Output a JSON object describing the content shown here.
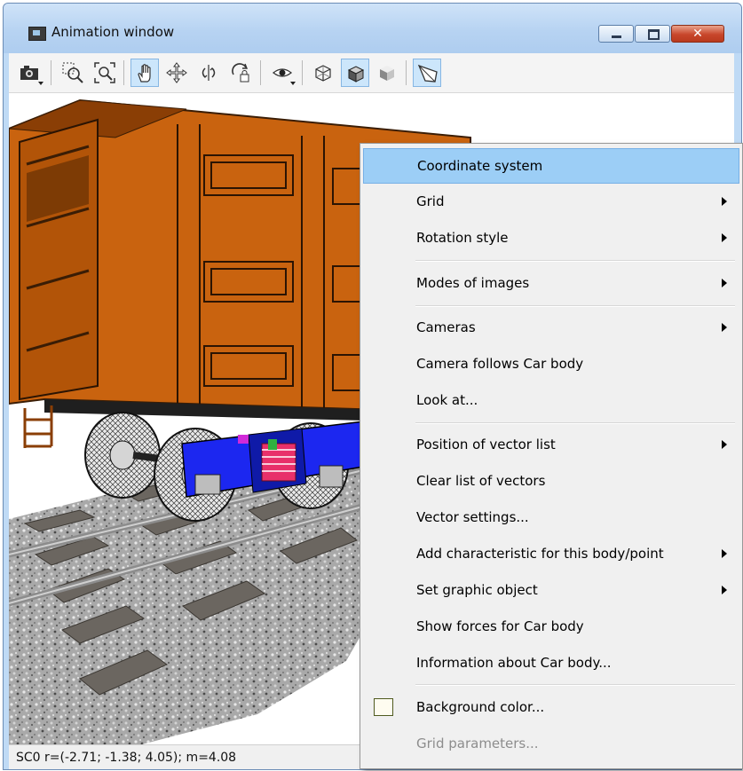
{
  "window": {
    "title": "Animation window",
    "close_glyph": "✕"
  },
  "toolbar": {
    "buttons": [
      {
        "icon": "camera-snapshot-icon",
        "active": false
      },
      {
        "icon": "zoom-region-icon",
        "active": false
      },
      {
        "icon": "zoom-fit-icon",
        "active": false
      },
      {
        "icon": "pan-hand-icon",
        "active": true
      },
      {
        "icon": "move-arrows-icon",
        "active": false
      },
      {
        "icon": "rotate-horizontal-icon",
        "active": false
      },
      {
        "icon": "rotate-locked-icon",
        "active": false
      },
      {
        "icon": "visibility-eye-icon",
        "active": false
      },
      {
        "icon": "wireframe-cube-icon",
        "active": false
      },
      {
        "icon": "shaded-cube-icon",
        "active": true
      },
      {
        "icon": "solid-cube-icon",
        "active": false
      },
      {
        "icon": "perspective-view-icon",
        "active": true
      }
    ]
  },
  "status": {
    "text": "SC0 r=(-2.71; -1.38; 4.05); m=4.08"
  },
  "context_menu": {
    "items": [
      {
        "label": "Coordinate system",
        "highlighted": true
      },
      {
        "label": "Grid",
        "submenu": true
      },
      {
        "label": "Rotation style",
        "submenu": true
      },
      {
        "label": "Modes of images",
        "submenu": true
      },
      {
        "label": "Cameras",
        "submenu": true
      },
      {
        "label": "Camera follows Car body"
      },
      {
        "label": "Look at..."
      },
      {
        "label": "Position of vector list",
        "submenu": true
      },
      {
        "label": "Clear list of vectors"
      },
      {
        "label": "Vector settings..."
      },
      {
        "label": "Add characteristic for this body/point",
        "submenu": true
      },
      {
        "label": "Set graphic object",
        "submenu": true
      },
      {
        "label": "Show forces for Car body"
      },
      {
        "label": "Information about Car body..."
      },
      {
        "label": "Background color...",
        "swatch": "#fefcf0"
      },
      {
        "label": "Grid parameters...",
        "disabled": true
      }
    ]
  },
  "colors": {
    "wagon_body": "#c9630f",
    "bogie_frame": "#1c27f0",
    "spring": "#e8306a",
    "menu_highlight": "#9ccef6",
    "background": "#ffffff"
  }
}
